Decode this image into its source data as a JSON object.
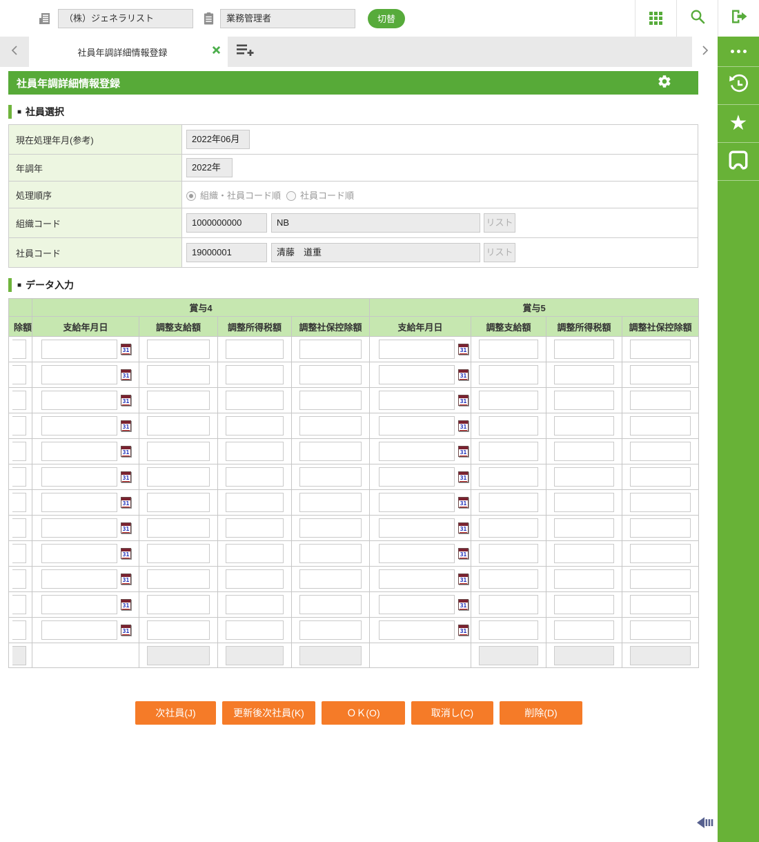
{
  "top_bar": {
    "company_field": "（株）ジェネラリスト",
    "role_field": "業務管理者",
    "switch_button": "切替"
  },
  "tab_bar": {
    "active_tab_title": "社員年調詳細情報登録"
  },
  "page_header": {
    "title": "社員年調詳細情報登録"
  },
  "employee_select": {
    "bullet": "■",
    "section_title": "社員選択",
    "current_month": {
      "label": "現在処理年月(参考)",
      "value": "2022年06月"
    },
    "nencho_year": {
      "label": "年調年",
      "value": "2022年"
    },
    "process_order": {
      "label": "処理順序",
      "option1": "組織・社員コード順",
      "option2": "社員コード順"
    },
    "org_code": {
      "label": "組織コード",
      "code": "1000000000",
      "name": "NB",
      "list_button": "リスト"
    },
    "emp_code": {
      "label": "社員コード",
      "code": "19000001",
      "name": "清藤　道重",
      "list_button": "リスト"
    }
  },
  "data_entry": {
    "bullet": "■",
    "section_title": "データ入力",
    "clipped_column_header": "除額",
    "groups": [
      "賞与4",
      "賞与5"
    ],
    "columns": [
      "支給年月日",
      "調整支給額",
      "調整所得税額",
      "調整社保控除額"
    ],
    "row_count": 12
  },
  "icons": {
    "calendar_day": "31",
    "star": "★"
  },
  "action_buttons": [
    "次社員(J)",
    "更新後次社員(K)",
    "ＯＫ(O)",
    "取消し(C)",
    "削除(D)"
  ]
}
